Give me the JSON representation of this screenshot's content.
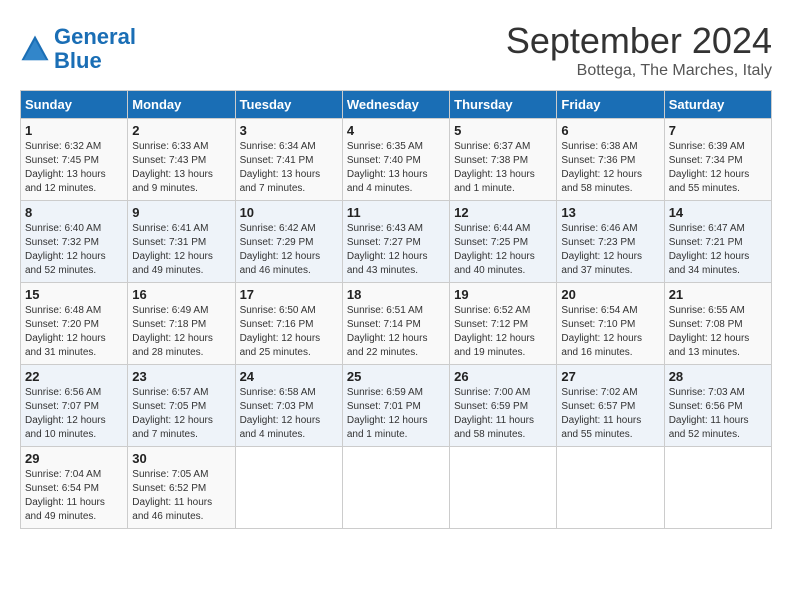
{
  "logo": {
    "line1": "General",
    "line2": "Blue"
  },
  "title": "September 2024",
  "subtitle": "Bottega, The Marches, Italy",
  "days_header": [
    "Sunday",
    "Monday",
    "Tuesday",
    "Wednesday",
    "Thursday",
    "Friday",
    "Saturday"
  ],
  "weeks": [
    [
      {
        "num": "1",
        "sunrise": "6:32 AM",
        "sunset": "7:45 PM",
        "daylight": "13 hours and 12 minutes."
      },
      {
        "num": "2",
        "sunrise": "6:33 AM",
        "sunset": "7:43 PM",
        "daylight": "13 hours and 9 minutes."
      },
      {
        "num": "3",
        "sunrise": "6:34 AM",
        "sunset": "7:41 PM",
        "daylight": "13 hours and 7 minutes."
      },
      {
        "num": "4",
        "sunrise": "6:35 AM",
        "sunset": "7:40 PM",
        "daylight": "13 hours and 4 minutes."
      },
      {
        "num": "5",
        "sunrise": "6:37 AM",
        "sunset": "7:38 PM",
        "daylight": "13 hours and 1 minute."
      },
      {
        "num": "6",
        "sunrise": "6:38 AM",
        "sunset": "7:36 PM",
        "daylight": "12 hours and 58 minutes."
      },
      {
        "num": "7",
        "sunrise": "6:39 AM",
        "sunset": "7:34 PM",
        "daylight": "12 hours and 55 minutes."
      }
    ],
    [
      {
        "num": "8",
        "sunrise": "6:40 AM",
        "sunset": "7:32 PM",
        "daylight": "12 hours and 52 minutes."
      },
      {
        "num": "9",
        "sunrise": "6:41 AM",
        "sunset": "7:31 PM",
        "daylight": "12 hours and 49 minutes."
      },
      {
        "num": "10",
        "sunrise": "6:42 AM",
        "sunset": "7:29 PM",
        "daylight": "12 hours and 46 minutes."
      },
      {
        "num": "11",
        "sunrise": "6:43 AM",
        "sunset": "7:27 PM",
        "daylight": "12 hours and 43 minutes."
      },
      {
        "num": "12",
        "sunrise": "6:44 AM",
        "sunset": "7:25 PM",
        "daylight": "12 hours and 40 minutes."
      },
      {
        "num": "13",
        "sunrise": "6:46 AM",
        "sunset": "7:23 PM",
        "daylight": "12 hours and 37 minutes."
      },
      {
        "num": "14",
        "sunrise": "6:47 AM",
        "sunset": "7:21 PM",
        "daylight": "12 hours and 34 minutes."
      }
    ],
    [
      {
        "num": "15",
        "sunrise": "6:48 AM",
        "sunset": "7:20 PM",
        "daylight": "12 hours and 31 minutes."
      },
      {
        "num": "16",
        "sunrise": "6:49 AM",
        "sunset": "7:18 PM",
        "daylight": "12 hours and 28 minutes."
      },
      {
        "num": "17",
        "sunrise": "6:50 AM",
        "sunset": "7:16 PM",
        "daylight": "12 hours and 25 minutes."
      },
      {
        "num": "18",
        "sunrise": "6:51 AM",
        "sunset": "7:14 PM",
        "daylight": "12 hours and 22 minutes."
      },
      {
        "num": "19",
        "sunrise": "6:52 AM",
        "sunset": "7:12 PM",
        "daylight": "12 hours and 19 minutes."
      },
      {
        "num": "20",
        "sunrise": "6:54 AM",
        "sunset": "7:10 PM",
        "daylight": "12 hours and 16 minutes."
      },
      {
        "num": "21",
        "sunrise": "6:55 AM",
        "sunset": "7:08 PM",
        "daylight": "12 hours and 13 minutes."
      }
    ],
    [
      {
        "num": "22",
        "sunrise": "6:56 AM",
        "sunset": "7:07 PM",
        "daylight": "12 hours and 10 minutes."
      },
      {
        "num": "23",
        "sunrise": "6:57 AM",
        "sunset": "7:05 PM",
        "daylight": "12 hours and 7 minutes."
      },
      {
        "num": "24",
        "sunrise": "6:58 AM",
        "sunset": "7:03 PM",
        "daylight": "12 hours and 4 minutes."
      },
      {
        "num": "25",
        "sunrise": "6:59 AM",
        "sunset": "7:01 PM",
        "daylight": "12 hours and 1 minute."
      },
      {
        "num": "26",
        "sunrise": "7:00 AM",
        "sunset": "6:59 PM",
        "daylight": "11 hours and 58 minutes."
      },
      {
        "num": "27",
        "sunrise": "7:02 AM",
        "sunset": "6:57 PM",
        "daylight": "11 hours and 55 minutes."
      },
      {
        "num": "28",
        "sunrise": "7:03 AM",
        "sunset": "6:56 PM",
        "daylight": "11 hours and 52 minutes."
      }
    ],
    [
      {
        "num": "29",
        "sunrise": "7:04 AM",
        "sunset": "6:54 PM",
        "daylight": "11 hours and 49 minutes."
      },
      {
        "num": "30",
        "sunrise": "7:05 AM",
        "sunset": "6:52 PM",
        "daylight": "11 hours and 46 minutes."
      },
      null,
      null,
      null,
      null,
      null
    ]
  ]
}
